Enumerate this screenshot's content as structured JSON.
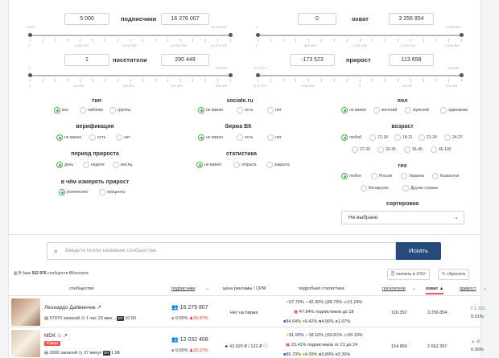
{
  "filters": {
    "subs": {
      "label": "подписчики",
      "min": "5 000",
      "max": "16 276 007",
      "tmin": "0 000",
      "tmax": "16 276 007",
      "ticks": [
        "0",
        "1 000 000",
        "5 000 000",
        "10 000 000",
        "16 276 007"
      ]
    },
    "reach": {
      "label": "охват",
      "min": "0",
      "max": "3 256 854",
      "tmin": "0",
      "tmax": "3 256 854",
      "ticks": [
        "0",
        "800 000",
        "1 200 000",
        "2 000 000",
        "3 256 854"
      ]
    },
    "visitors": {
      "label": "посетители",
      "min": "1",
      "max": "290 449",
      "tmin": "1",
      "tmax": "290 449",
      "ticks": [
        "1",
        "50 000",
        "100 000",
        "200 000",
        "290 449"
      ]
    },
    "growth": {
      "label": "прирост",
      "min": "-173 523",
      "max": "113 658",
      "tmin": "-173 523",
      "tmax": "113 658",
      "ticks": [
        "-173 523",
        "-100 000",
        "0",
        "50 000",
        "113 658"
      ]
    }
  },
  "groups": {
    "type": {
      "title": "тип",
      "options": [
        "все",
        "паблики",
        "группы"
      ],
      "selected": 0
    },
    "verification": {
      "title": "верификация",
      "options": [
        "не важно",
        "есть",
        "нет"
      ],
      "selected": 0
    },
    "growth_period": {
      "title": "период прироста",
      "options": [
        "день",
        "неделя",
        "месяц"
      ],
      "selected": 0
    },
    "measure": {
      "title": "в чём измерять прирост",
      "options": [
        "количество",
        "проценты"
      ],
      "selected": 0
    },
    "sociate": {
      "title": "sociate.ru",
      "options": [
        "не важно",
        "есть",
        "нет"
      ],
      "selected": 0
    },
    "exchange": {
      "title": "биржа ВК",
      "options": [
        "не важно",
        "есть",
        "нет"
      ],
      "selected": 0
    },
    "stats": {
      "title": "статистика",
      "options": [
        "не важно",
        "открыта",
        "закрыта"
      ],
      "selected": 0
    },
    "gender": {
      "title": "пол",
      "options": [
        "не важно",
        "женский",
        "мужской",
        "одинаково"
      ],
      "selected": 0
    },
    "age": {
      "title": "возраст",
      "options": [
        "любой",
        "12-18",
        "18-21",
        "21-24",
        "24-27",
        "27-30",
        "30-35",
        "35-45",
        "45-100"
      ],
      "selected": 0
    },
    "geo": {
      "title": "гео",
      "options": [
        "любое",
        "Россия",
        "Украина",
        "Казахстан",
        "Беларусия",
        "Другие страны"
      ],
      "selected": 0
    },
    "sort": {
      "title": "сортировка",
      "value": "Не выбрано"
    }
  },
  "search": {
    "placeholder": "Введите id или название сообщества",
    "button": "Искать"
  },
  "info": {
    "prefix": "В базе",
    "count": "502 976",
    "suffix": "сообществ ВКонтакте"
  },
  "actions": {
    "csv": "скачать в CSV",
    "reset": "сбросить"
  },
  "columns": [
    "сообщество",
    "подписчики",
    "цена рекламы / CPM",
    "подробная статистика",
    "посетители",
    "охват",
    "прирост"
  ],
  "rows": [
    {
      "name": "Леонардо Дайвинчик",
      "badge": "",
      "posts": "57970 записей",
      "ago": "1 час 23 мин...",
      "er": "ER",
      "er_val": "10.50",
      "subs": "16 275 807",
      "subs_pct": "0.00%",
      "subs_red": "25.87%",
      "price": "Нет на бирже",
      "male": "57.70%",
      "female": "42.30%",
      "mobile": "88.76%",
      "desktop": "11.24%",
      "age_note": "47.84% подписчиков до 18",
      "f1": "84.64%",
      "f2": "6.42%",
      "f3": "4.96%",
      "f4": "1.67%",
      "visitors": "116 352",
      "reach": "3 256 854",
      "growth": "1 331",
      "growth_pct": "0.01%",
      "dir": "up"
    },
    {
      "name": "MDK",
      "badge": "Юмор",
      "posts": "0300 записей",
      "ago": "37 минут",
      "er": "ER",
      "er_val": "1.98",
      "subs": "12 032 408",
      "subs_pct": "0.00%",
      "subs_red": "26.37%",
      "price": "43 920 ₽ / 122 ₽",
      "male": "81.90%",
      "female": "18.10%",
      "mobile": "60.81%",
      "desktop": "39.19%",
      "age_note": "23.41% подписчиков от 21 до 24",
      "f1": "86.73%",
      "f2": "4.39%",
      "f3": "3.89%",
      "f4": "3.39%",
      "visitors": "154 856",
      "reach": "2 662 357",
      "growth": "-8",
      "growth_pct": "0.00%",
      "dir": "down"
    }
  ]
}
